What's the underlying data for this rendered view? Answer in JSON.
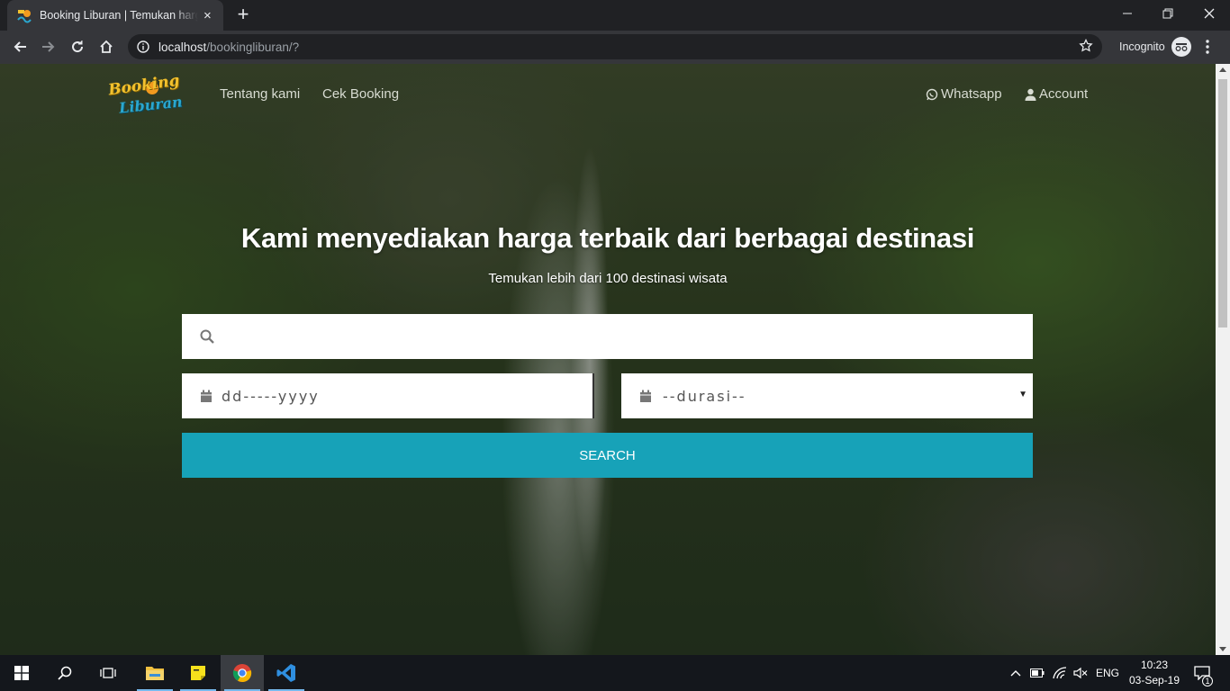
{
  "browser": {
    "tab": {
      "title": "Booking Liburan | Temukan harga terbaik",
      "close_icon": "×",
      "favicon": "booking-liburan-favicon"
    },
    "new_tab_icon": "+",
    "window_controls": {
      "minimize": "—",
      "maximize": "❐",
      "close": "✕"
    },
    "url": {
      "host": "localhost",
      "path": "/bookingliburan/?"
    },
    "incognito_label": "Incognito"
  },
  "site": {
    "logo": {
      "line1": "Booking",
      "line2": "Liburan"
    },
    "nav": {
      "about": "Tentang kami",
      "check_booking": "Cek Booking"
    },
    "nav_right": {
      "whatsapp": "Whatsapp",
      "account": "Account"
    },
    "hero": {
      "title": "Kami menyediakan harga terbaik dari berbagai destinasi",
      "subtitle": "Temukan lebih dari 100 destinasi wisata"
    },
    "search": {
      "value": "",
      "placeholder": ""
    },
    "date_field": {
      "value": "dd-----yyyy"
    },
    "duration_field": {
      "selected": "--durasi--"
    },
    "search_button": "SEARCH"
  },
  "taskbar": {
    "clock": {
      "time": "10:23",
      "date": "03-Sep-19"
    },
    "language": "ENG",
    "notification_count": "1"
  },
  "colors": {
    "accent": "#17a2b8",
    "chrome_dark": "#202124",
    "chrome_toolbar": "#35363a",
    "taskbar": "#14171c"
  }
}
